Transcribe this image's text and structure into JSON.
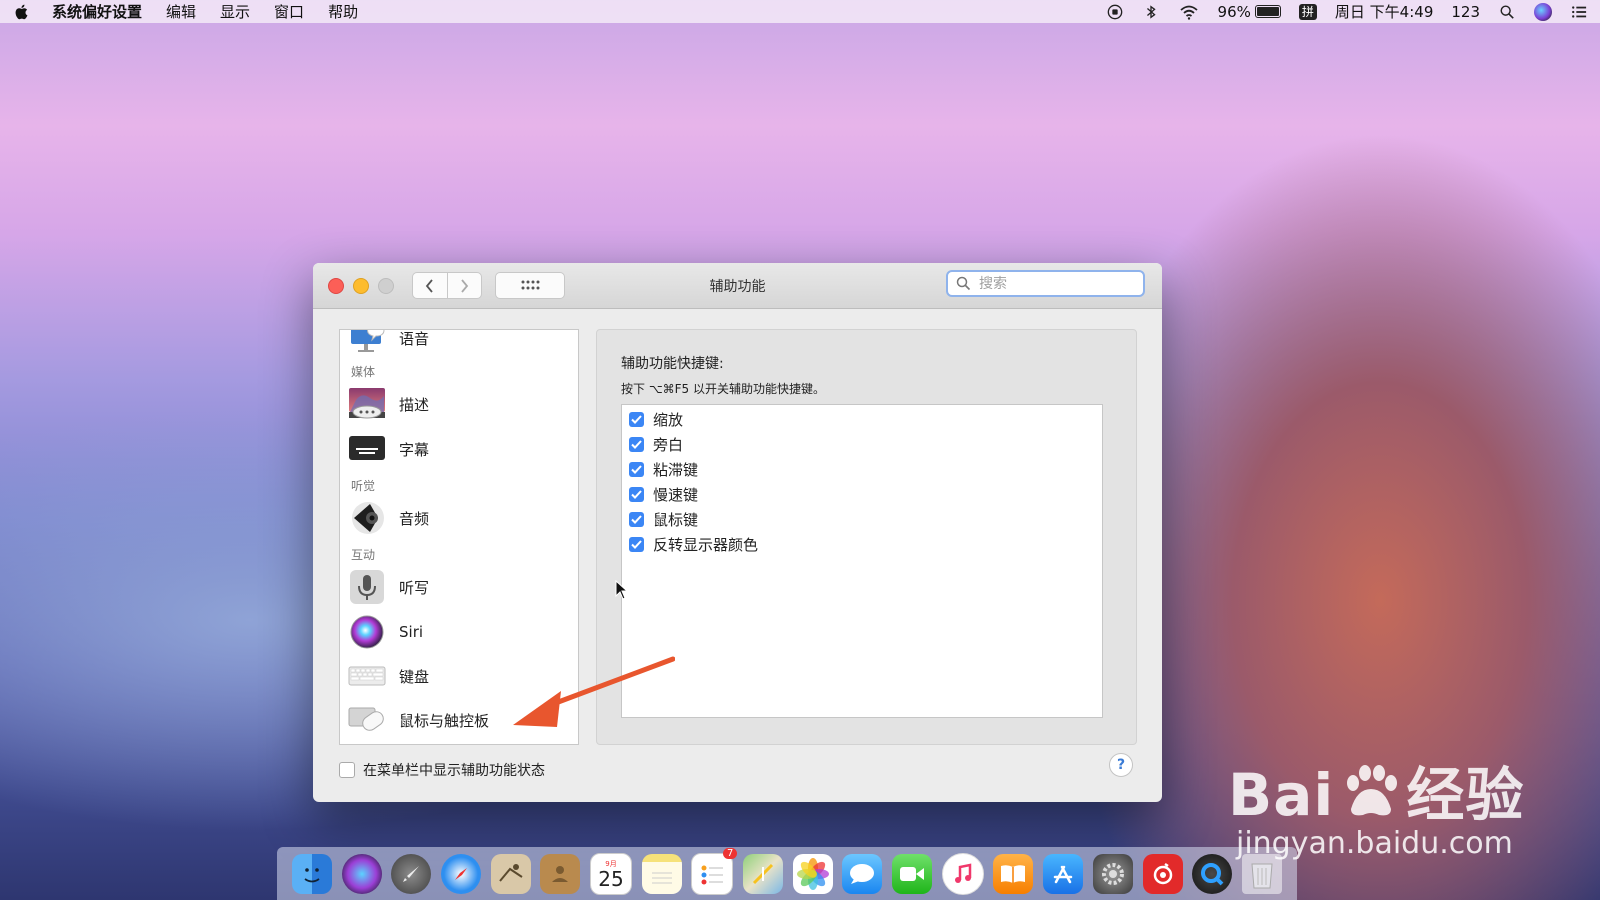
{
  "menubar": {
    "app": "系统偏好设置",
    "items": [
      "编辑",
      "显示",
      "窗口",
      "帮助"
    ],
    "battery": "96%",
    "input_method": "拼",
    "clock": "周日 下午4:49",
    "extra": "123"
  },
  "window": {
    "title": "辅助功能",
    "search_placeholder": "搜索"
  },
  "sidebar": {
    "items": [
      {
        "label": "语音",
        "icon": "speech-icon"
      },
      {
        "category": "媒体"
      },
      {
        "label": "描述",
        "icon": "descriptions-icon"
      },
      {
        "label": "字幕",
        "icon": "captions-icon"
      },
      {
        "category": "听觉"
      },
      {
        "label": "音频",
        "icon": "audio-icon"
      },
      {
        "category": "互动"
      },
      {
        "label": "听写",
        "icon": "dictation-icon"
      },
      {
        "label": "Siri",
        "icon": "siri-icon"
      },
      {
        "label": "键盘",
        "icon": "keyboard-icon"
      },
      {
        "label": "鼠标与触控板",
        "icon": "mouse-trackpad-icon"
      }
    ]
  },
  "panel": {
    "title": "辅助功能快捷键:",
    "desc": "按下 ⌥⌘F5 以开关辅助功能快捷键。",
    "options": [
      {
        "label": "缩放",
        "checked": true
      },
      {
        "label": "旁白",
        "checked": true
      },
      {
        "label": "粘滞键",
        "checked": true
      },
      {
        "label": "慢速键",
        "checked": true
      },
      {
        "label": "鼠标键",
        "checked": true
      },
      {
        "label": "反转显示器颜色",
        "checked": true
      }
    ]
  },
  "footer": {
    "menubar_checkbox": "在菜单栏中显示辅助功能状态",
    "help": "?"
  },
  "dock": {
    "calendar_day": "25",
    "calendar_month": "9月",
    "reminders_badge": "7"
  },
  "watermark": {
    "brand_latin": "Bai",
    "brand_zh": "经验",
    "url": "jingyan.baidu.com"
  },
  "colors": {
    "accent": "#3b86f5",
    "arrow": "#e8562e"
  }
}
